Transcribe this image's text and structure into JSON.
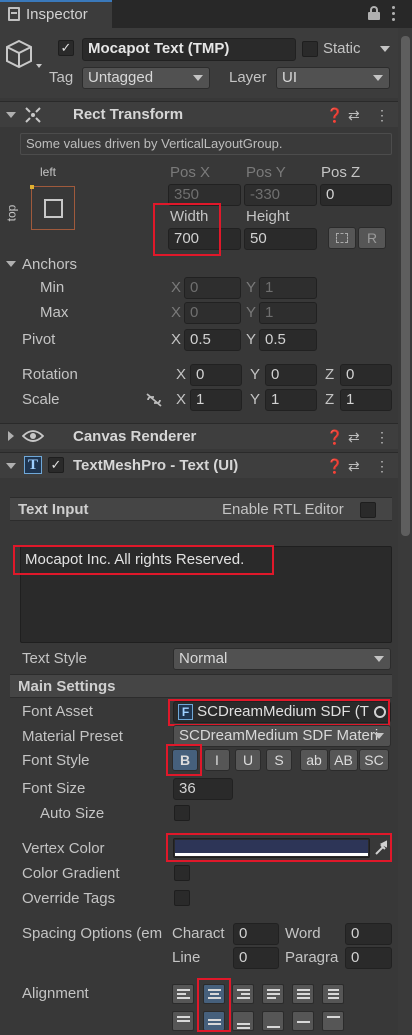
{
  "tab": {
    "title": "Inspector"
  },
  "object": {
    "name": "Mocapot Text (TMP)",
    "static_label": "Static",
    "tag_label": "Tag",
    "tag_value": "Untagged",
    "layer_label": "Layer",
    "layer_value": "UI"
  },
  "rect_transform": {
    "title": "Rect Transform",
    "info": "Some values driven by VerticalLayoutGroup.",
    "anchor_preset_h": "left",
    "anchor_preset_v": "top",
    "pos_x_label": "Pos X",
    "pos_y_label": "Pos Y",
    "pos_z_label": "Pos Z",
    "pos_x": "350",
    "pos_y": "-330",
    "pos_z": "0",
    "width_label": "Width",
    "height_label": "Height",
    "width": "700",
    "height": "50",
    "blueprint_btn": "R",
    "anchors_label": "Anchors",
    "min_label": "Min",
    "max_label": "Max",
    "x_label": "X",
    "y_label": "Y",
    "z_label": "Z",
    "min_x": "0",
    "min_y": "1",
    "max_x": "0",
    "max_y": "1",
    "pivot_label": "Pivot",
    "pivot_x": "0.5",
    "pivot_y": "0.5",
    "rotation_label": "Rotation",
    "rot_x": "0",
    "rot_y": "0",
    "rot_z": "0",
    "scale_label": "Scale",
    "scale_x": "1",
    "scale_y": "1",
    "scale_z": "1"
  },
  "canvas_renderer": {
    "title": "Canvas Renderer"
  },
  "tmp": {
    "title": "TextMeshPro - Text (UI)",
    "icon_letter": "T",
    "text_input_label": "Text Input",
    "rtl_label": "Enable RTL Editor",
    "text_value": "Mocapot Inc. All rights Reserved.",
    "text_style_label": "Text Style",
    "text_style_value": "Normal",
    "main_settings_label": "Main Settings",
    "font_asset_label": "Font Asset",
    "font_asset_icon": "F",
    "font_asset_value": "SCDreamMedium SDF (T",
    "material_preset_label": "Material Preset",
    "material_preset_value": "SCDreamMedium SDF Materi",
    "font_style_label": "Font Style",
    "font_style_buttons": [
      "B",
      "I",
      "U",
      "S",
      "ab",
      "AB",
      "SC"
    ],
    "font_size_label": "Font Size",
    "font_size_value": "36",
    "auto_size_label": "Auto Size",
    "vertex_color_label": "Vertex Color",
    "vertex_color": "#2d3557",
    "color_gradient_label": "Color Gradient",
    "override_tags_label": "Override Tags",
    "spacing_label": "Spacing Options (em",
    "character_label": "Charact",
    "character_value": "0",
    "word_label": "Word",
    "word_value": "0",
    "line_label": "Line",
    "line_value": "0",
    "paragraph_label": "Paragra",
    "paragraph_value": "0",
    "alignment_label": "Alignment",
    "align_h_selected": "center",
    "align_v_selected": "middle"
  },
  "colors": {
    "highlight": "#e0182a",
    "selected_button": "#46607c",
    "background": "#383838"
  },
  "icons": [
    "inspector-tab-icon",
    "lock-icon",
    "kebab-menu-icon",
    "gameobject-cube-icon",
    "rect-transform-icon",
    "help-icon",
    "preset-icon",
    "component-menu-icon",
    "eye-icon",
    "tmp-text-icon",
    "eyedropper-icon",
    "object-picker-icon",
    "unlink-scale-icon"
  ]
}
